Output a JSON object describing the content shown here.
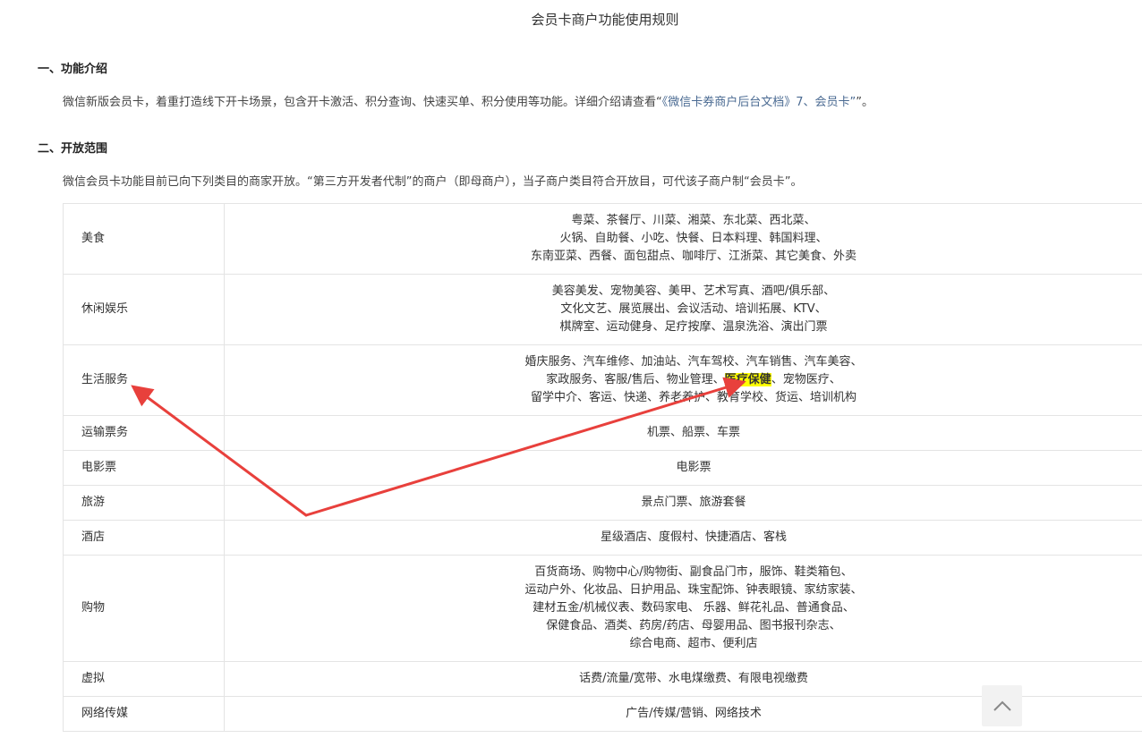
{
  "page": {
    "title": "会员卡商户功能使用规则"
  },
  "sections": [
    {
      "heading": "一、功能介绍",
      "paragraph_prefix": "微信新版会员卡，着重打造线下开卡场景，包含开卡激活、积分查询、快速买单、积分使用等功能。详细介绍请查看“",
      "paragraph_link": "《微信卡券商户后台文档》7、会员卡”",
      "paragraph_suffix": "”。"
    },
    {
      "heading": "二、开放范围",
      "paragraph": "微信会员卡功能目前已向下列类目的商家开放。“第三方开发者代制”的商户（即母商户），当子商户类目符合开放目，可代该子商户制“会员卡”。"
    }
  ],
  "categories": [
    {
      "name": "美食",
      "lines": [
        "粤菜、茶餐厅、川菜、湘菜、东北菜、西北菜、",
        "火锅、自助餐、小吃、快餐、日本料理、韩国料理、",
        "东南亚菜、西餐、面包甜点、咖啡厅、江浙菜、其它美食、外卖"
      ]
    },
    {
      "name": "休闲娱乐",
      "lines": [
        "美容美发、宠物美容、美甲、艺术写真、酒吧/俱乐部、",
        "文化文艺、展览展出、会议活动、培训拓展、KTV、",
        "棋牌室、运动健身、足疗按摩、温泉洗浴、演出门票"
      ]
    },
    {
      "name": "生活服务",
      "lines": [
        "婚庆服务、汽车维修、加油站、汽车驾校、汽车销售、汽车美容、",
        "家政服务、客服/售后、物业管理、",
        "留学中介、客运、快递、养老养护、教育学校、货运、培训机构"
      ],
      "highlight": "医疗保健",
      "line2_after": "、宠物医疗、"
    },
    {
      "name": "运输票务",
      "lines": [
        "机票、船票、车票"
      ]
    },
    {
      "name": "电影票",
      "lines": [
        "电影票"
      ]
    },
    {
      "name": "旅游",
      "lines": [
        "景点门票、旅游套餐"
      ]
    },
    {
      "name": "酒店",
      "lines": [
        "星级酒店、度假村、快捷酒店、客栈"
      ]
    },
    {
      "name": "购物",
      "lines": [
        "百货商场、购物中心/购物街、副食品门市，服饰、鞋类箱包、",
        "运动户外、化妆品、日护用品、珠宝配饰、钟表眼镜、家纺家装、",
        "建材五金/机械仪表、数码家电、 乐器、鲜花礼品、普通食品、",
        "保健食品、酒类、药房/药店、母婴用品、图书报刊杂志、",
        "综合电商、超市、便利店"
      ]
    },
    {
      "name": "虚拟",
      "lines": [
        "话费/流量/宽带、水电煤缴费、有限电视缴费"
      ]
    },
    {
      "name": "网络传媒",
      "lines": [
        "广告/传媒/营销、网络技术"
      ]
    }
  ],
  "colors": {
    "arrow": "#e8403c",
    "highlight": "#ffff00",
    "link": "#4a6a92",
    "border": "#e4e4e4"
  },
  "icons": {
    "scroll_top": "chevron-up-icon"
  }
}
